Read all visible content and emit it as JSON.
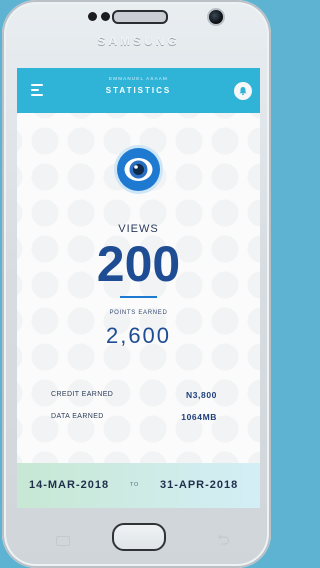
{
  "device": {
    "brand": "SAMSUNG"
  },
  "header": {
    "subtitle": "EMMANUEL ASAAM",
    "title": "STATISTICS"
  },
  "stats": {
    "views_label": "VIEWS",
    "views_value": "200",
    "points_label": "POINTS EARNED",
    "points_value": "2,600",
    "credit_label": "CREDIT EARNED",
    "credit_value": "N3,800",
    "data_label": "DATA EARNED",
    "data_value": "1064MB"
  },
  "footer": {
    "from_date": "14-MAR-2018",
    "to_label": "TO",
    "to_date": "31-APR-2018"
  },
  "colors": {
    "accent": "#2fb4d8",
    "primary_text": "#1f4d94",
    "eye_icon": "#1e79d0"
  },
  "icons": {
    "menu": "hamburger-menu-icon",
    "notifications": "bell-icon",
    "views": "eye-icon"
  }
}
